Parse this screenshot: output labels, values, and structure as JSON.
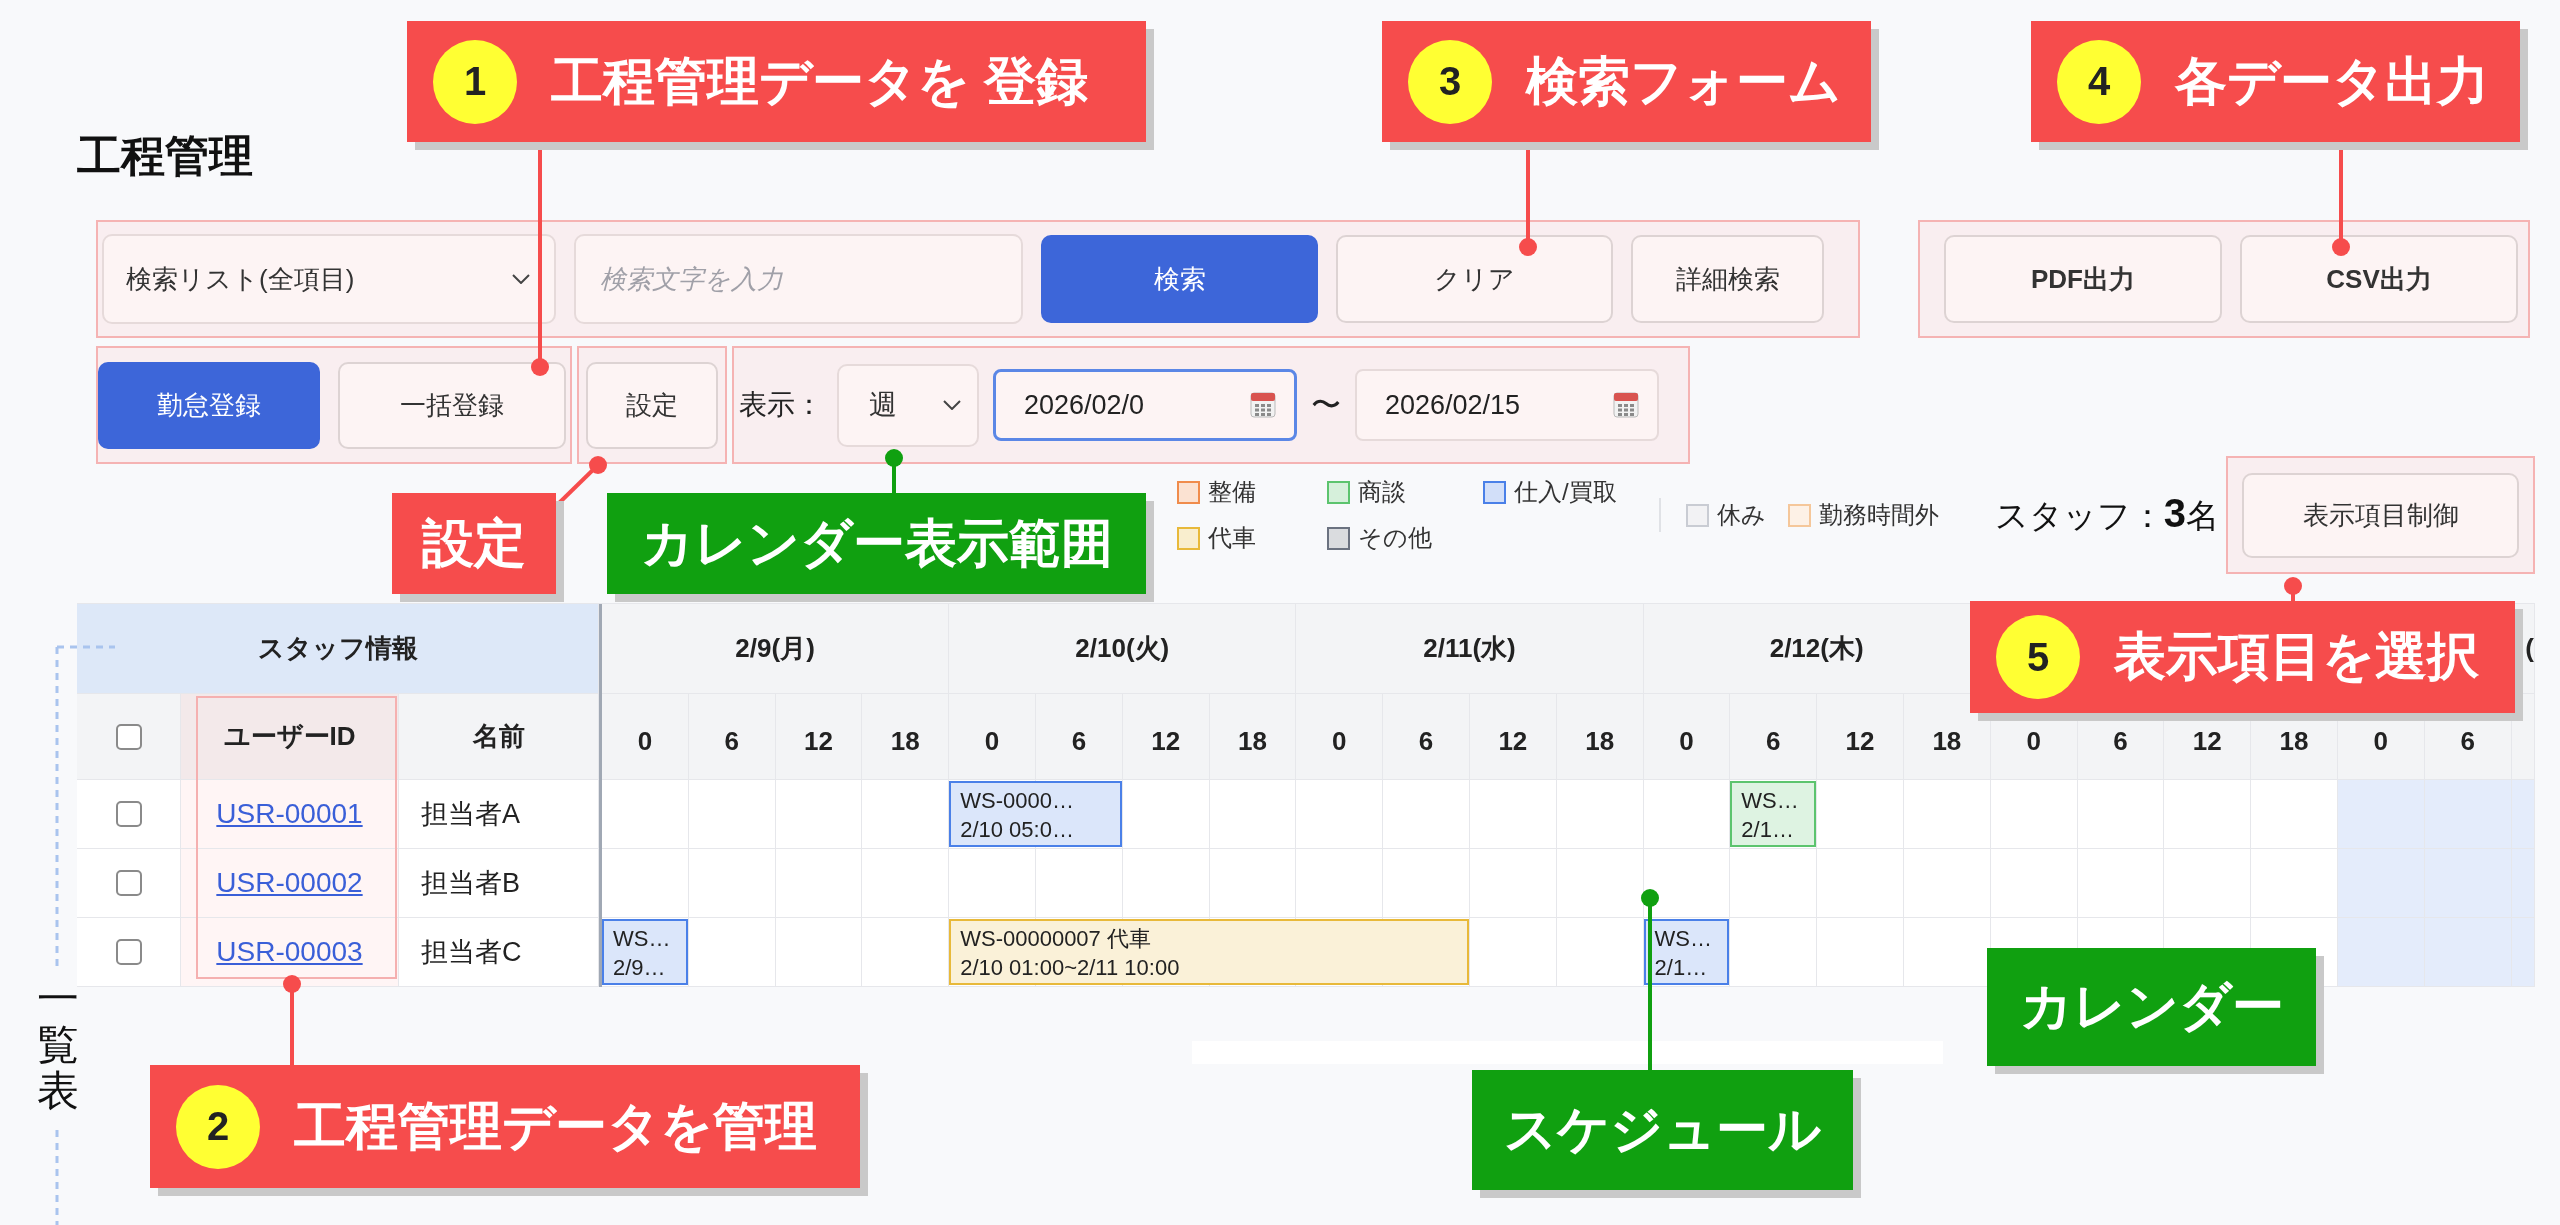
{
  "page": {
    "title": "工程管理"
  },
  "search": {
    "list_select": "検索リスト(全項目)",
    "keyword": {
      "placeholder": "検索文字を入力"
    },
    "buttons": [
      {
        "label": "検索",
        "kind": "primary"
      },
      {
        "label": "クリア",
        "kind": "default"
      },
      {
        "label": "詳細検索",
        "kind": "default"
      }
    ]
  },
  "export_buttons": [
    "PDF出力",
    "CSV出力"
  ],
  "register_buttons": [
    {
      "label": "勤怠登録",
      "kind": "primary"
    },
    {
      "label": "一括登録",
      "kind": "default"
    }
  ],
  "settings_button": "設定",
  "display": {
    "label": "表示：",
    "period": "週",
    "start_date": {
      "value": "2026/02/0",
      "focused": true
    },
    "separator": "〜",
    "end_date": {
      "value": "2026/02/15",
      "focused": false
    }
  },
  "legend": {
    "categories": [
      {
        "label": "整備",
        "color": "#f08c4c"
      },
      {
        "label": "商談",
        "color": "#5cc46e"
      },
      {
        "label": "仕入/買取",
        "color": "#4a80e8"
      },
      {
        "label": "代車",
        "color": "#e8b93a"
      },
      {
        "label": "その他",
        "color": "#6b7280"
      }
    ],
    "statuses": [
      {
        "label": "休み",
        "color": "#c9ccd3"
      },
      {
        "label": "勤務時間外",
        "color": "#f5c79a"
      }
    ]
  },
  "staff_count": "スタッフ：**3**名",
  "column_control_button": "表示項目制御",
  "table": {
    "group_header": "スタッフ情報",
    "select_all_checked": false,
    "columns": [
      "ユーザーID",
      "名前"
    ],
    "rows": [
      {
        "checked": false,
        "user_id": "USR-00001",
        "name": "担当者A"
      },
      {
        "checked": false,
        "user_id": "USR-00002",
        "name": "担当者B"
      },
      {
        "checked": false,
        "user_id": "USR-00003",
        "name": "担当者C"
      }
    ]
  },
  "calendar": {
    "days": [
      {
        "label": "2/9(月)",
        "weekend": false,
        "hours": [
          "0",
          "6",
          "12",
          "18"
        ]
      },
      {
        "label": "2/10(火)",
        "weekend": false,
        "hours": [
          "0",
          "6",
          "12",
          "18"
        ]
      },
      {
        "label": "2/11(水)",
        "weekend": false,
        "hours": [
          "0",
          "6",
          "12",
          "18"
        ]
      },
      {
        "label": "2/12(木)",
        "weekend": false,
        "hours": [
          "0",
          "6",
          "12",
          "18"
        ]
      },
      {
        "weekend": false,
        "hours": [
          "0",
          "6",
          "12",
          "18"
        ]
      },
      {
        "label": "(",
        "weekend": true,
        "hours": [
          "0",
          "6"
        ]
      }
    ],
    "rows": [
      {
        "slots": [
          {
            "kind": "empty"
          },
          {
            "kind": "empty"
          },
          {
            "kind": "empty"
          },
          {
            "kind": "empty"
          },
          {
            "kind": "event",
            "color": "#4a80e8",
            "lines": [
              "WS-0000…",
              "2/10 05:0…"
            ]
          },
          {
            "kind": "cont"
          },
          {
            "kind": "empty"
          },
          {
            "kind": "empty"
          },
          {
            "kind": "empty"
          },
          {
            "kind": "empty"
          },
          {
            "kind": "empty"
          },
          {
            "kind": "empty"
          },
          {
            "kind": "empty"
          },
          {
            "kind": "event",
            "color": "#5cc46e",
            "lines": [
              "WS…",
              "2/1…"
            ]
          },
          {
            "kind": "empty"
          },
          {
            "kind": "empty"
          },
          {
            "kind": "empty"
          },
          {
            "kind": "empty"
          },
          {
            "kind": "empty"
          },
          {
            "kind": "empty"
          },
          {
            "kind": "empty"
          },
          {
            "kind": "empty"
          }
        ]
      },
      {
        "slots": [
          {
            "kind": "empty"
          },
          {
            "kind": "empty"
          },
          {
            "kind": "empty"
          },
          {
            "kind": "empty"
          },
          {
            "kind": "empty"
          },
          {
            "kind": "empty"
          },
          {
            "kind": "empty"
          },
          {
            "kind": "empty"
          },
          {
            "kind": "empty"
          },
          {
            "kind": "empty"
          },
          {
            "kind": "empty"
          },
          {
            "kind": "empty"
          },
          {
            "kind": "empty"
          },
          {
            "kind": "empty"
          },
          {
            "kind": "empty"
          },
          {
            "kind": "empty"
          },
          {
            "kind": "empty"
          },
          {
            "kind": "empty"
          },
          {
            "kind": "empty"
          },
          {
            "kind": "empty"
          },
          {
            "kind": "empty"
          },
          {
            "kind": "empty"
          }
        ]
      },
      {
        "slots": [
          {
            "kind": "event",
            "color": "#4a80e8",
            "lines": [
              "WS…",
              "2/9…"
            ]
          },
          {
            "kind": "empty"
          },
          {
            "kind": "empty"
          },
          {
            "kind": "empty"
          },
          {
            "kind": "event",
            "color": "#e8b93a",
            "lines": [
              "WS-00000007 代車",
              "2/10 01:00~2/11 10:00"
            ]
          },
          {
            "kind": "cont"
          },
          {
            "kind": "cont"
          },
          {
            "kind": "cont"
          },
          {
            "kind": "cont"
          },
          {
            "kind": "cont"
          },
          {
            "kind": "empty"
          },
          {
            "kind": "empty"
          },
          {
            "kind": "event",
            "color": "#4a80e8",
            "lines": [
              "WS…",
              "2/1…"
            ]
          },
          {
            "kind": "empty"
          },
          {
            "kind": "empty"
          },
          {
            "kind": "empty"
          },
          {
            "kind": "empty"
          },
          {
            "kind": "empty"
          },
          {
            "kind": "empty"
          },
          {
            "kind": "empty"
          },
          {
            "kind": "empty"
          },
          {
            "kind": "empty"
          }
        ]
      }
    ]
  },
  "annotations": [
    {
      "number": "1",
      "text": "工程管理データを 登録",
      "color": "#f64c4c",
      "leader": true
    },
    {
      "number": "3",
      "text": "検索フォーム",
      "color": "#f64c4c",
      "leader": true
    },
    {
      "number": "4",
      "text": "各データ出力",
      "color": "#f64c4c",
      "leader": true
    },
    {
      "text": "設定",
      "color": "#f64c4c",
      "leader": true
    },
    {
      "text": "カレンダー表示範囲",
      "color": "#10a010",
      "leader": true
    },
    {
      "number": "5",
      "text": "表示項目を選択",
      "color": "#f64c4c",
      "leader": true
    },
    {
      "text": "カレンダー",
      "color": "#10a010",
      "leader": false
    },
    {
      "number": "2",
      "text": "工程管理データを管理",
      "color": "#f64c4c",
      "leader": true
    },
    {
      "text": "スケジュール",
      "color": "#10a010",
      "leader": true
    }
  ],
  "side_label": "一覧表"
}
